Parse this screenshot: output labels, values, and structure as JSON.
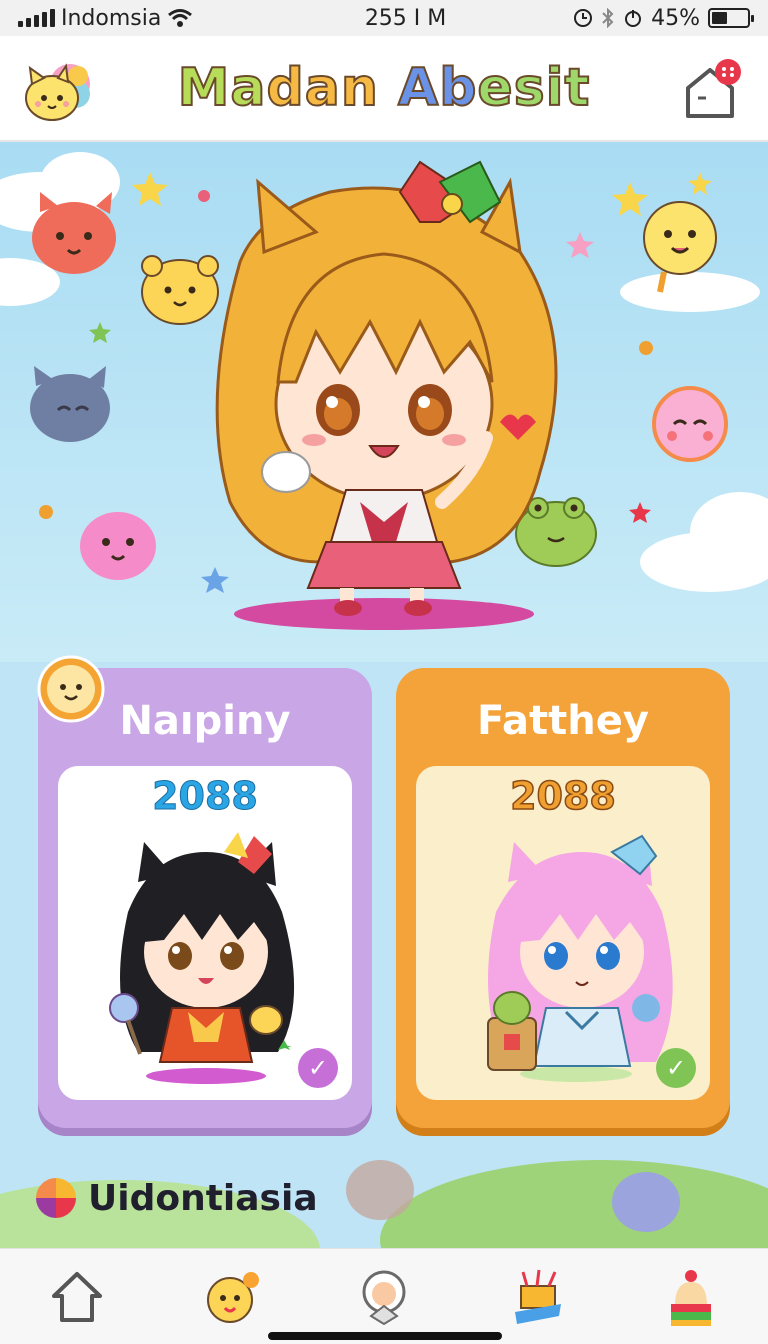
{
  "status_bar": {
    "carrier": "Indomsia",
    "time": "255 I M",
    "battery": "45%",
    "battery_level": 0.45
  },
  "header": {
    "title_parts": [
      "Ma",
      "dan",
      " Ab",
      "esit"
    ],
    "logo_icon": "kitten-logo-icon",
    "home_icon": "home-notification-icon"
  },
  "cards": [
    {
      "title": "Naıpiny",
      "score": "2088",
      "color": "#c9a6e6",
      "checked": true
    },
    {
      "title": "Fatthey",
      "score": "2088",
      "color": "#f4a23a",
      "checked": true
    }
  ],
  "section": {
    "label": "Uidontiasia"
  },
  "bottom_nav": [
    {
      "icon": "home-icon"
    },
    {
      "icon": "character-icon"
    },
    {
      "icon": "avatar-icon"
    },
    {
      "icon": "toys-icon"
    },
    {
      "icon": "hat-icon"
    }
  ],
  "colors": {
    "sky": "#bfe4f5",
    "accent_purple": "#c9a6e6",
    "accent_orange": "#f4a23a"
  }
}
